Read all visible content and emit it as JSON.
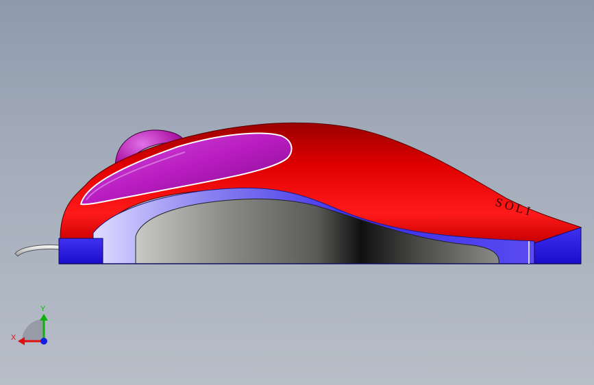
{
  "viewport": {
    "model": "mouse-side-view",
    "logo_text": "SOLI",
    "colors": {
      "shell": "#e00000",
      "button": "#c020c8",
      "wheel": "#b01aa8",
      "base": "#3c24ea",
      "side_panel": "#9c94f2",
      "grip": "#6a6a66",
      "cable": "#e6e6e6",
      "background_top": "#8e9aab",
      "background_bottom": "#b7bec8"
    }
  },
  "triad": {
    "x_label": "X",
    "y_label": "Y",
    "x_color": "#e01010",
    "y_color": "#10b010",
    "z_color": "#1020e0"
  }
}
